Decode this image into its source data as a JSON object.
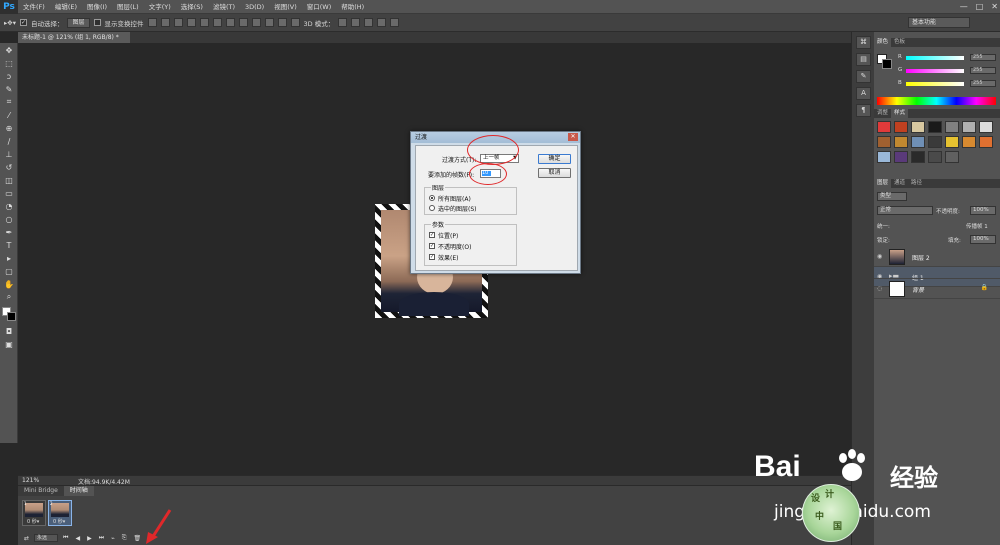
{
  "menubar": {
    "logo": "Ps",
    "items": [
      "文件(F)",
      "编辑(E)",
      "图像(I)",
      "图层(L)",
      "文字(Y)",
      "选择(S)",
      "滤镜(T)",
      "3D(D)",
      "视图(V)",
      "窗口(W)",
      "帮助(H)"
    ],
    "win_controls": [
      "—",
      "□",
      "✕"
    ]
  },
  "options_bar": {
    "auto_select_label": "自动选择：",
    "auto_select_value": "图层",
    "show_transform_label": "显示变换控件",
    "mode_3d_label": "3D 模式：",
    "workspace": "基本功能"
  },
  "document_tab": {
    "title": "未标题-1 @ 121% (组 1, RGB/8) *"
  },
  "dialog": {
    "title": "过渡",
    "tween_with_label": "过渡方式(T):",
    "tween_with_value": "上一帧",
    "frames_to_add_label": "要添加的帧数(F):",
    "frames_to_add_value": "10",
    "ok_label": "确定",
    "cancel_label": "取消",
    "layers_group_title": "图层",
    "radio_all_layers": "所有图层(A)",
    "radio_selected_layers": "选中的图层(S)",
    "params_group_title": "参数",
    "check_position": "位置(P)",
    "check_opacity": "不透明度(O)",
    "check_effects": "效果(E)"
  },
  "statusbar": {
    "zoom": "121%",
    "doc_size": "文档:94.9K/4.42M"
  },
  "timeline": {
    "tabs": [
      "Mini Bridge",
      "时间轴"
    ],
    "active_tab": "时间轴",
    "frames": [
      {
        "num": "1",
        "delay": "0 秒▾"
      },
      {
        "num": "2",
        "delay": "0 秒▾"
      }
    ],
    "loop": "永远",
    "controls": [
      "⏮",
      "◀",
      "▶",
      "⏭"
    ]
  },
  "color_panel": {
    "tabs": [
      "颜色",
      "色板"
    ],
    "r_label": "R",
    "g_label": "G",
    "b_label": "B",
    "r_value": "255",
    "g_value": "255",
    "b_value": "255"
  },
  "styles_panel": {
    "tabs": [
      "调整",
      "样式"
    ],
    "swatch_colors": [
      "#e03a3a",
      "#c04020",
      "#d8c8a0",
      "#1a1a1a",
      "#808080",
      "#b0b0b0",
      "#dcdcdc",
      "#a06030",
      "#c08830",
      "#6f8fb5",
      "#3a3a3a",
      "#e6c230",
      "#d88a30",
      "#e07030",
      "#9ab8d8",
      "#5a3a7a",
      "#2a2a2a",
      "#4a4a4a",
      "#606060"
    ]
  },
  "layers_panel": {
    "tabs": [
      "图层",
      "通道",
      "路径"
    ],
    "kind": "类型",
    "blend_mode": "正常",
    "opacity_label": "不透明度:",
    "opacity_value": "100%",
    "unify_label": "统一:",
    "propagate_label": "传播帧 1",
    "lock_label": "锁定:",
    "fill_label": "填充:",
    "fill_value": "100%",
    "layers": [
      {
        "name": "图层 2",
        "selected": false
      },
      {
        "name": "组 1",
        "selected": true
      },
      {
        "name": "背景",
        "selected": false
      }
    ]
  },
  "watermark": {
    "brand": "Bai",
    "brand2": "经验",
    "url": "jingyan.baidu.com",
    "badge_chars": [
      "设",
      "计",
      "中",
      "国"
    ]
  }
}
